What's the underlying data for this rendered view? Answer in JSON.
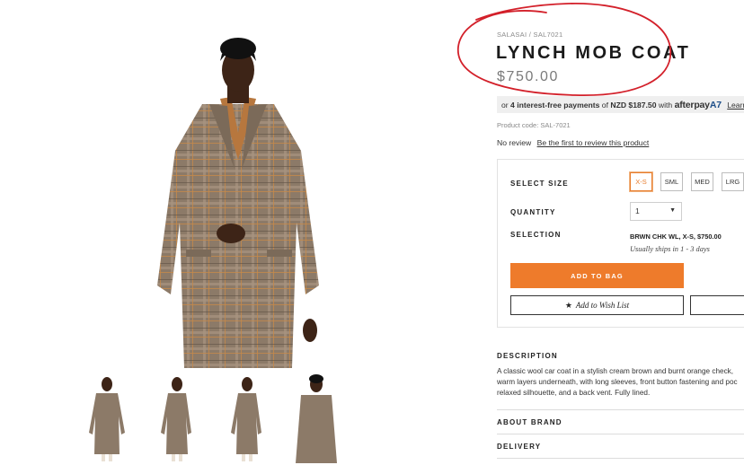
{
  "product": {
    "breadcrumb": "SALASAI / SAL7021",
    "title": "LYNCH MOB COAT",
    "price": "$750.00",
    "product_code": "Product code: SAL-7021"
  },
  "afterpay": {
    "prefix": "or",
    "bold_text": "4 interest-free payments",
    "middle": "of",
    "amount": "NZD $187.50",
    "with": "with",
    "logo_text": "afterpay",
    "logo_mark": "A7",
    "learn_more": "Learn m"
  },
  "reviews": {
    "status": "No review",
    "link": "Be the first to review this product"
  },
  "options": {
    "size_label": "SELECT SIZE",
    "sizes": [
      "X-S",
      "SML",
      "MED",
      "LRG"
    ],
    "selected_size": "X-S",
    "quantity_label": "QUANTITY",
    "quantity_value": "1",
    "selection_label": "SELECTION",
    "selection_value": "BRWN CHK WL, X-S, $750.00",
    "ship_note": "Usually ships in 1 - 3 days",
    "add_to_bag": "ADD TO BAG",
    "wish_list": "Add to Wish List"
  },
  "description": {
    "heading": "DESCRIPTION",
    "lines": [
      "A classic wool car coat in a stylish cream brown and burnt orange check,",
      "warm layers underneath, with long sleeves, front button fastening and poc",
      "relaxed silhouette, and a back vent. Fully lined."
    ]
  },
  "accordions": {
    "about_brand": "ABOUT BRAND",
    "delivery": "DELIVERY"
  },
  "colors": {
    "accent": "#ee7b2b",
    "annotation": "#d3202a",
    "coat": "#8a7866"
  }
}
